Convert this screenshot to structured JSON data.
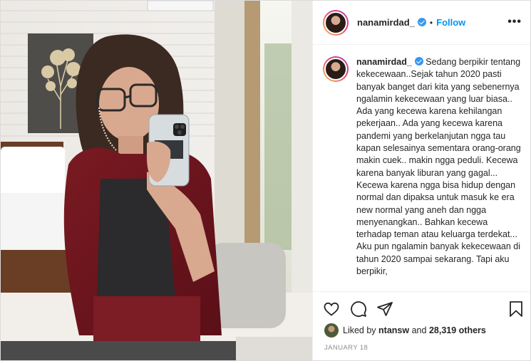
{
  "post": {
    "username": "nanamirdad_",
    "follow_label": "Follow",
    "separator": "•",
    "more_label": "•••",
    "caption": "Sedang berpikir tentang kekecewaan..Sejak tahun 2020 pasti banyak banget dari kita yang sebenernya ngalamin kekecewaan yang luar biasa.. Ada yang kecewa karena kehilangan pekerjaan.. Ada yang kecewa karena pandemi yang berkelanjutan ngga tau kapan selesainya sementara orang-orang makin cuek.. makin ngga peduli. Kecewa karena banyak liburan yang gagal... Kecewa karena ngga bisa hidup dengan normal dan dipaksa untuk masuk ke era new normal yang aneh dan ngga menyenangkan.. Bahkan kecewa terhadap teman atau keluarga terdekat... Aku pun ngalamin banyak kekecewaan di tahun 2020 sampai sekarang. Tapi aku berpikir,",
    "likes": {
      "prefix": "Liked by",
      "first_user": "ntansw",
      "joiner": "and",
      "others": "28,319 others"
    },
    "date": "JANUARY 18"
  },
  "icons": {
    "like": "heart-icon",
    "comment": "comment-icon",
    "share": "share-icon",
    "save": "bookmark-icon",
    "verified": "verified-badge-icon"
  },
  "colors": {
    "follow_blue": "#0095f6",
    "verified_blue": "#3897f0",
    "text": "#262626",
    "muted": "#8e8e8e"
  }
}
